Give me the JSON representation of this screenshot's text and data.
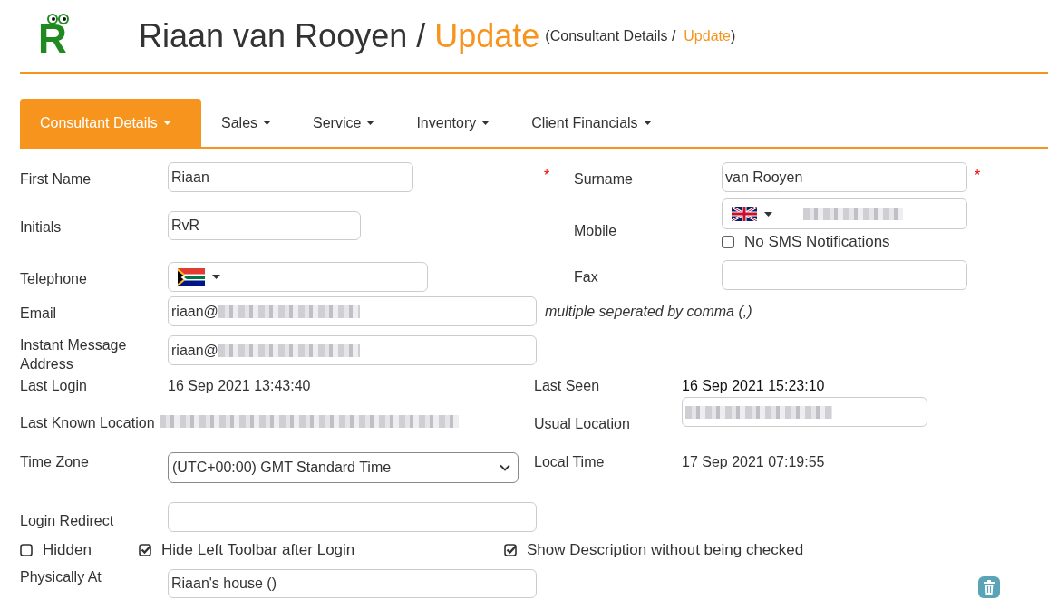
{
  "header": {
    "logo": "R",
    "title": "Riaan van Rooyen",
    "separator": "/",
    "action": "Update",
    "breadcrumb_section": "(Consultant Details",
    "breadcrumb_separator": "/",
    "breadcrumb_action": "Update",
    "breadcrumb_close": ")"
  },
  "tabs": [
    {
      "label": "Consultant Details",
      "selected": true
    },
    {
      "label": "Sales",
      "selected": false
    },
    {
      "label": "Service",
      "selected": false
    },
    {
      "label": "Inventory",
      "selected": false
    },
    {
      "label": "Client Financials",
      "selected": false
    }
  ],
  "form": {
    "first_name": {
      "label": "First Name",
      "value": "Riaan",
      "required_mark": "*"
    },
    "initials": {
      "label": "Initials",
      "value": "RvR"
    },
    "telephone": {
      "label": "Telephone"
    },
    "surname": {
      "label": "Surname",
      "value": "van Rooyen",
      "required_mark": "*"
    },
    "mobile": {
      "label": "Mobile"
    },
    "no_sms": {
      "label": "No SMS Notifications",
      "checked": false
    },
    "fax": {
      "label": "Fax"
    },
    "email": {
      "label": "Email",
      "value": "riaan@",
      "note": "multiple seperated by comma (,)"
    },
    "instant_message": {
      "label": "Instant Message Address",
      "value": "riaan@"
    },
    "last_login": {
      "label": "Last Login",
      "value": "16 Sep 2021 13:43:40"
    },
    "last_seen": {
      "label": "Last Seen",
      "value": "16 Sep 2021 15:23:10"
    },
    "last_known_location": {
      "label": "Last Known Location"
    },
    "usual_location": {
      "label": "Usual Location"
    },
    "time_zone": {
      "label": "Time Zone",
      "value": "(UTC+00:00) GMT Standard Time"
    },
    "local_time": {
      "label": "Local Time",
      "value": "17 Sep 2021 07:19:55"
    },
    "login_redirect": {
      "label": "Login Redirect"
    },
    "options": [
      {
        "label": "Hidden",
        "checked": false
      },
      {
        "label": "Hide Left Toolbar after Login",
        "checked": true
      },
      {
        "label": "Show Description without being checked",
        "checked": true
      }
    ],
    "physically_at": {
      "label": "Physically At",
      "value": "Riaan's house ()"
    }
  }
}
